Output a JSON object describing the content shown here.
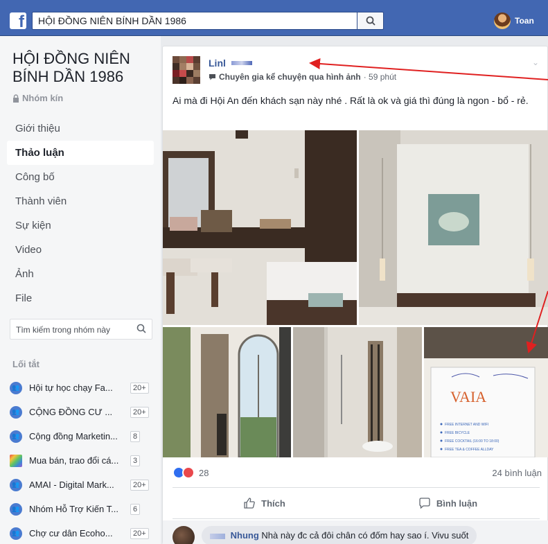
{
  "topbar": {
    "search_value": "HỘI ĐỒNG NIÊN BÍNH DẦN 1986",
    "user_name": "Toan"
  },
  "group": {
    "title": "HỘI ĐỒNG NIÊN BÍNH DẦN 1986",
    "privacy": "Nhóm kín",
    "nav": [
      "Giới thiệu",
      "Thảo luận",
      "Công bố",
      "Thành viên",
      "Sự kiện",
      "Video",
      "Ảnh",
      "File"
    ],
    "active_nav": "Thảo luận",
    "search_placeholder": "Tìm kiếm trong nhóm này",
    "shortcuts_title": "Lối tắt",
    "shortcuts": [
      {
        "label": "Hội tự học chạy Fa...",
        "badge": "20+",
        "icon": "group-icon"
      },
      {
        "label": "CỘNG ĐỒNG CƯ ...",
        "badge": "20+",
        "icon": "group-icon"
      },
      {
        "label": "Cộng đồng Marketin...",
        "badge": "8",
        "icon": "group-icon"
      },
      {
        "label": "Mua bán, trao đổi cá...",
        "badge": "3",
        "icon": "rainbow-icon"
      },
      {
        "label": "AMAI - Digital Mark...",
        "badge": "20+",
        "icon": "group-icon"
      },
      {
        "label": "Nhóm Hỗ Trợ Kiến T...",
        "badge": "6",
        "icon": "group-icon"
      },
      {
        "label": "Chợ cư dân Ecoho...",
        "badge": "20+",
        "icon": "group-icon"
      }
    ]
  },
  "post": {
    "author": "Linl",
    "badge": "Chuyên gia kể chuyện qua hình ảnh",
    "time": "· 59 phút",
    "text": "Ai mà đi Hội An đến khách sạn này nhé . Rất là ok và giá thì đúng là ngon - bổ - rẻ.",
    "reaction_count": "28",
    "comment_count": "24 bình luận",
    "like_label": "Thích",
    "comment_label": "Bình luận",
    "photo_card_brand": "VAIA",
    "photo_card_lines": [
      "FREE INTERNET AND WIFI",
      "FREE BICYCLE",
      "FREE COCKTAIL (16:00 TO 18:00)",
      "FREE TEA & COFFEE ALLDAY"
    ],
    "first_comment": {
      "author": "Nhung",
      "text": "Nhà này đc cả đôi chân có đốm hay sao í. Vivu suốt"
    }
  }
}
